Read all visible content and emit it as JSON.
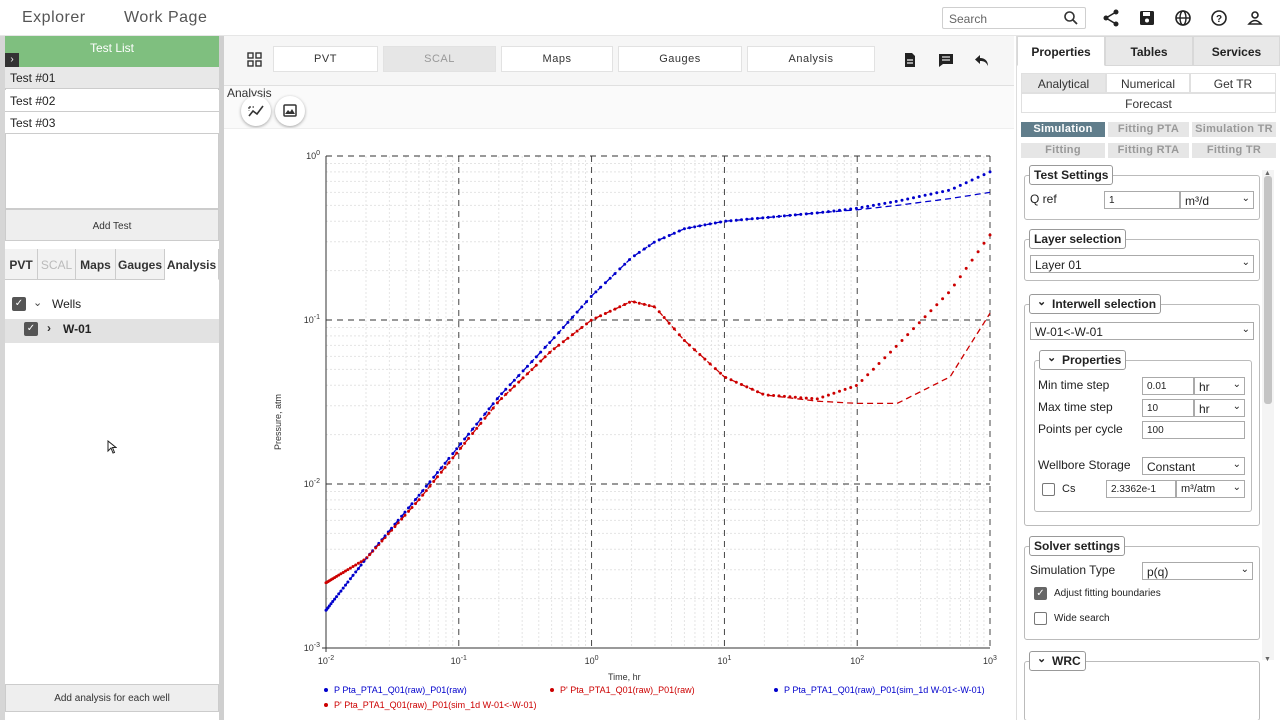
{
  "topbar": {
    "tab_explorer": "Explorer",
    "tab_workpage": "Work Page",
    "search_placeholder": "Search"
  },
  "left": {
    "testlist_title": "Test List",
    "tests": [
      "Test #01",
      "Test #02",
      "Test #03"
    ],
    "add_test": "Add Test",
    "tabs": [
      "PVT",
      "SCAL",
      "Maps",
      "Gauges",
      "Analysis"
    ],
    "wells_label": "Wells",
    "well_name": "W-01",
    "add_analysis": "Add analysis for each well"
  },
  "center": {
    "toolbar": [
      "PVT",
      "SCAL",
      "Maps",
      "Gauges",
      "Analysis"
    ],
    "analysis_tag": "Analysis"
  },
  "chart_data": {
    "type": "line",
    "xscale": "log",
    "yscale": "log",
    "xlim": [
      0.01,
      1000
    ],
    "ylim": [
      0.001,
      1
    ],
    "xlabel": "Time, hr",
    "ylabel": "Pressure, atm",
    "x_ticks": [
      "10^-2",
      "10^-1",
      "10^0",
      "10^1",
      "10^2",
      "10^3"
    ],
    "y_ticks": [
      "10^-3",
      "10^-2",
      "10^-1",
      "10^0"
    ],
    "grid": true,
    "series": [
      {
        "name": "P Pta_PTA1_Q01(raw)_P01(raw)",
        "color": "#0000cc",
        "style": "dotted",
        "x": [
          0.01,
          0.02,
          0.05,
          0.1,
          0.2,
          0.5,
          1,
          2,
          3,
          5,
          10,
          20,
          50,
          100,
          200,
          500,
          1000
        ],
        "y": [
          0.0017,
          0.0035,
          0.0085,
          0.017,
          0.034,
          0.075,
          0.14,
          0.24,
          0.3,
          0.36,
          0.4,
          0.42,
          0.45,
          0.48,
          0.53,
          0.62,
          0.8
        ]
      },
      {
        "name": "P' Pta_PTA1_Q01(raw)_P01(raw)",
        "color": "#cc0000",
        "style": "dotted",
        "x": [
          0.01,
          0.02,
          0.05,
          0.1,
          0.2,
          0.5,
          1,
          2,
          3,
          5,
          10,
          20,
          50,
          100,
          200,
          500,
          1000
        ],
        "y": [
          0.0025,
          0.0035,
          0.008,
          0.016,
          0.032,
          0.065,
          0.1,
          0.13,
          0.12,
          0.075,
          0.045,
          0.035,
          0.033,
          0.04,
          0.07,
          0.15,
          0.33
        ]
      },
      {
        "name": "P Pta_PTA1_Q01(raw)_P01(sim_1d W-01<-W-01)",
        "color": "#0000cc",
        "style": "dashed",
        "x": [
          0.01,
          0.02,
          0.05,
          0.1,
          0.2,
          0.5,
          1,
          2,
          3,
          5,
          10,
          20,
          50,
          100,
          200,
          500,
          1000
        ],
        "y": [
          0.0017,
          0.0035,
          0.0085,
          0.017,
          0.034,
          0.075,
          0.14,
          0.24,
          0.3,
          0.36,
          0.4,
          0.42,
          0.45,
          0.47,
          0.5,
          0.55,
          0.6
        ]
      },
      {
        "name": "P' Pta_PTA1_Q01(raw)_P01(sim_1d W-01<-W-01)",
        "color": "#cc0000",
        "style": "dashed",
        "x": [
          0.01,
          0.02,
          0.05,
          0.1,
          0.2,
          0.5,
          1,
          2,
          3,
          5,
          10,
          20,
          50,
          100,
          200,
          500,
          1000
        ],
        "y": [
          0.0025,
          0.0035,
          0.008,
          0.016,
          0.032,
          0.065,
          0.1,
          0.13,
          0.12,
          0.075,
          0.045,
          0.035,
          0.032,
          0.031,
          0.031,
          0.045,
          0.11
        ]
      }
    ]
  },
  "right": {
    "tabs": [
      "Properties",
      "Tables",
      "Services"
    ],
    "subtabs": [
      "Analytical",
      "Numerical",
      "Get TR",
      "Forecast"
    ],
    "modes": [
      "Simulation",
      "Fitting PTA",
      "Simulation TR",
      "Fitting",
      "Fitting RTA",
      "Fitting TR"
    ],
    "test_settings": {
      "title": "Test Settings",
      "qref_label": "Q ref",
      "qref_value": "1",
      "qref_unit": "m³/d"
    },
    "layer": {
      "title": "Layer selection",
      "value": "Layer 01"
    },
    "interwell": {
      "title": "Interwell selection",
      "value": "W-01<-W-01"
    },
    "properties": {
      "title": "Properties",
      "min_label": "Min time step",
      "min_value": "0.01",
      "min_unit": "hr",
      "max_label": "Max time step",
      "max_value": "10",
      "max_unit": "hr",
      "ppc_label": "Points per cycle",
      "ppc_value": "100",
      "wbs_label": "Wellbore Storage",
      "wbs_value": "Constant",
      "cs_label": "Cs",
      "cs_value": "2.3362e-1",
      "cs_unit": "m³/atm"
    },
    "solver": {
      "title": "Solver settings",
      "simtype_label": "Simulation Type",
      "simtype_value": "p(q)",
      "adjust_label": "Adjust fitting boundaries",
      "wide_label": "Wide search"
    },
    "wrc": {
      "title": "WRC"
    }
  }
}
